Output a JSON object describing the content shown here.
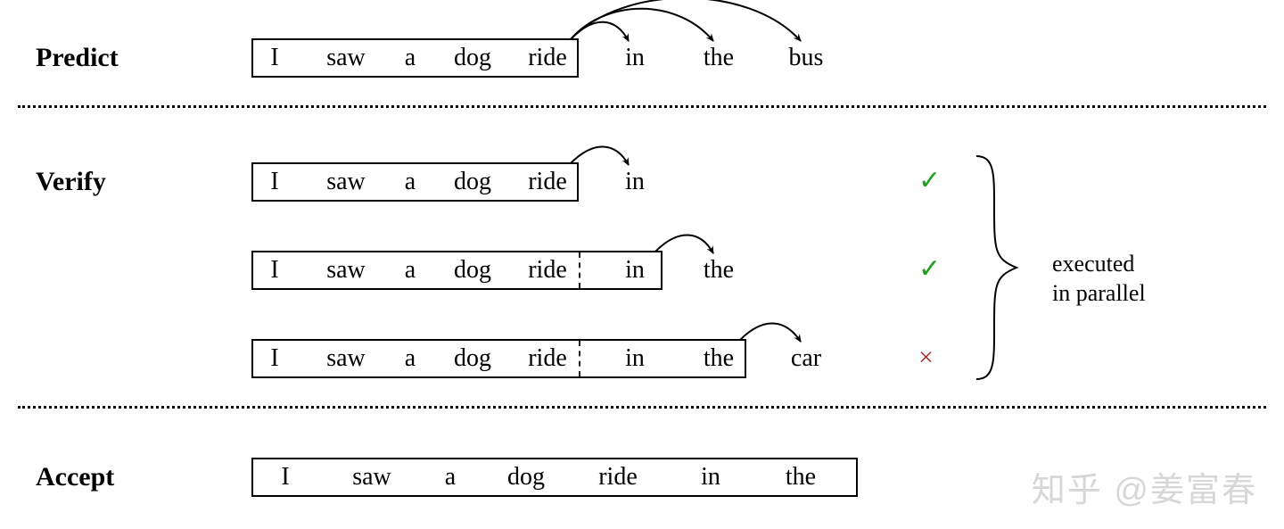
{
  "labels": {
    "predict": "Predict",
    "verify": "Verify",
    "accept": "Accept"
  },
  "tokens": {
    "I": "I",
    "saw": "saw",
    "a": "a",
    "dog": "dog",
    "ride": "ride",
    "in": "in",
    "the": "the",
    "bus": "bus",
    "car": "car"
  },
  "marks": {
    "check": "✓",
    "cross": "×"
  },
  "annotation": {
    "line1": "executed",
    "line2": "in parallel"
  },
  "watermark": "知乎 @姜富春"
}
